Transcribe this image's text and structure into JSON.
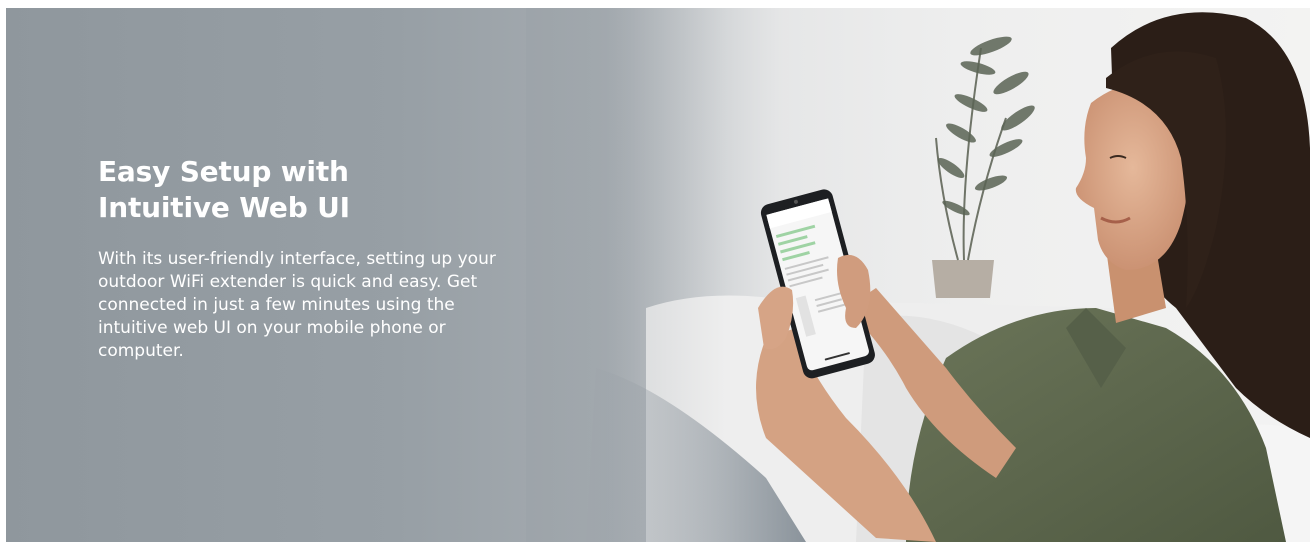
{
  "hero": {
    "title_line1": "Easy Setup with",
    "title_line2": "Intuitive Web UI",
    "description": "With its user-friendly interface, setting up your outdoor WiFi extender is quick and easy. Get connected in just a few minutes using the intuitive web UI on your mobile phone or computer."
  },
  "colors": {
    "text": "#ffffff",
    "background_left": "#8f979d",
    "background_right": "#ececec",
    "shirt": "#5f6a4e",
    "hair": "#2b1e17"
  },
  "icons": [
    "phone-icon"
  ]
}
